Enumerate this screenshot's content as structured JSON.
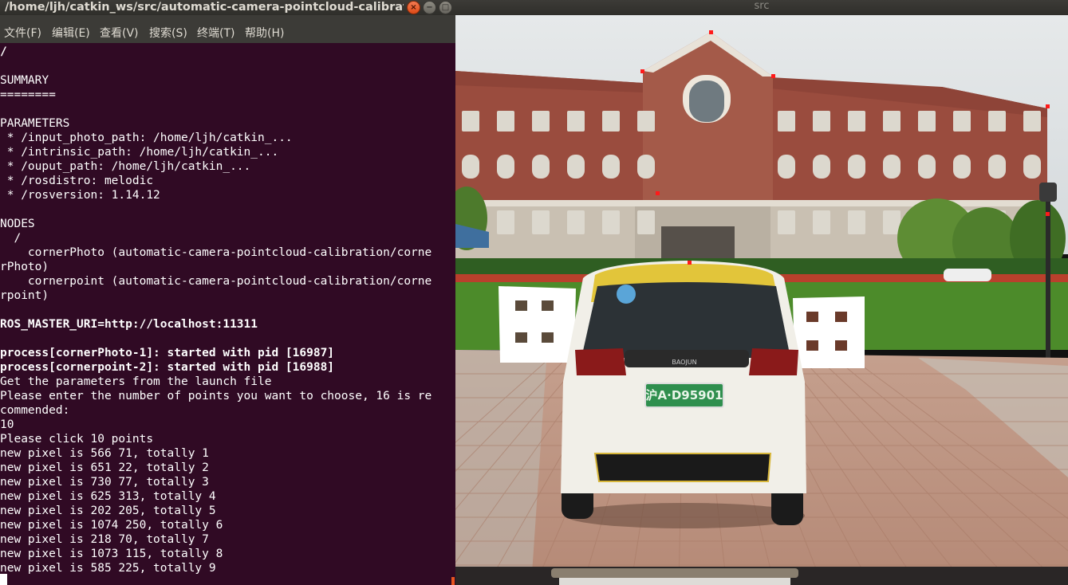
{
  "terminal": {
    "title": "/home/ljh/catkin_ws/src/automatic-camera-pointcloud-calibration/la...",
    "window_buttons": [
      "close-icon",
      "minimize-icon",
      "maximize-icon"
    ],
    "menu": [
      "文件(F)",
      "编辑(E)",
      "查看(V)",
      "搜索(S)",
      "终端(T)",
      "帮助(H)"
    ],
    "lines": [
      {
        "text": "/",
        "bold": true
      },
      {
        "text": "",
        "bold": false
      },
      {
        "text": "SUMMARY",
        "bold": false
      },
      {
        "text": "========",
        "bold": false
      },
      {
        "text": "",
        "bold": false
      },
      {
        "text": "PARAMETERS",
        "bold": false
      },
      {
        "text": " * /input_photo_path: /home/ljh/catkin_...",
        "bold": false
      },
      {
        "text": " * /intrinsic_path: /home/ljh/catkin_...",
        "bold": false
      },
      {
        "text": " * /ouput_path: /home/ljh/catkin_...",
        "bold": false
      },
      {
        "text": " * /rosdistro: melodic",
        "bold": false
      },
      {
        "text": " * /rosversion: 1.14.12",
        "bold": false
      },
      {
        "text": "",
        "bold": false
      },
      {
        "text": "NODES",
        "bold": false
      },
      {
        "text": "  /",
        "bold": false
      },
      {
        "text": "    cornerPhoto (automatic-camera-pointcloud-calibration/corne",
        "bold": false
      },
      {
        "text": "rPhoto)",
        "bold": false
      },
      {
        "text": "    cornerpoint (automatic-camera-pointcloud-calibration/corne",
        "bold": false
      },
      {
        "text": "rpoint)",
        "bold": false
      },
      {
        "text": "",
        "bold": false
      },
      {
        "text": "ROS_MASTER_URI=http://localhost:11311",
        "bold": true
      },
      {
        "text": "",
        "bold": false
      },
      {
        "text": "process[cornerPhoto-1]: started with pid [16987]",
        "bold": true
      },
      {
        "text": "process[cornerpoint-2]: started with pid [16988]",
        "bold": true
      },
      {
        "text": "Get the parameters from the launch file",
        "bold": false
      },
      {
        "text": "Please enter the number of points you want to choose, 16 is re",
        "bold": false
      },
      {
        "text": "commended:",
        "bold": false
      },
      {
        "text": "10",
        "bold": false
      },
      {
        "text": "Please click 10 points",
        "bold": false
      },
      {
        "text": "new pixel is 566 71, totally 1",
        "bold": false
      },
      {
        "text": "new pixel is 651 22, totally 2",
        "bold": false
      },
      {
        "text": "new pixel is 730 77, totally 3",
        "bold": false
      },
      {
        "text": "new pixel is 625 313, totally 4",
        "bold": false
      },
      {
        "text": "new pixel is 202 205, totally 5",
        "bold": false
      },
      {
        "text": "new pixel is 1074 250, totally 6",
        "bold": false
      },
      {
        "text": "new pixel is 218 70, totally 7",
        "bold": false
      },
      {
        "text": "new pixel is 1073 115, totally 8",
        "bold": false
      },
      {
        "text": "new pixel is 585 225, totally 9",
        "bold": false
      }
    ]
  },
  "viewer": {
    "title": "src",
    "license_plate": "沪A·D95901",
    "car_badge": "BAOJUN",
    "selected_points_count": 9
  },
  "colors": {
    "terminal_bg": "#300a24",
    "titlebar": "#3c3b37",
    "marker": "#ff1a1a",
    "accent": "#e95420"
  }
}
